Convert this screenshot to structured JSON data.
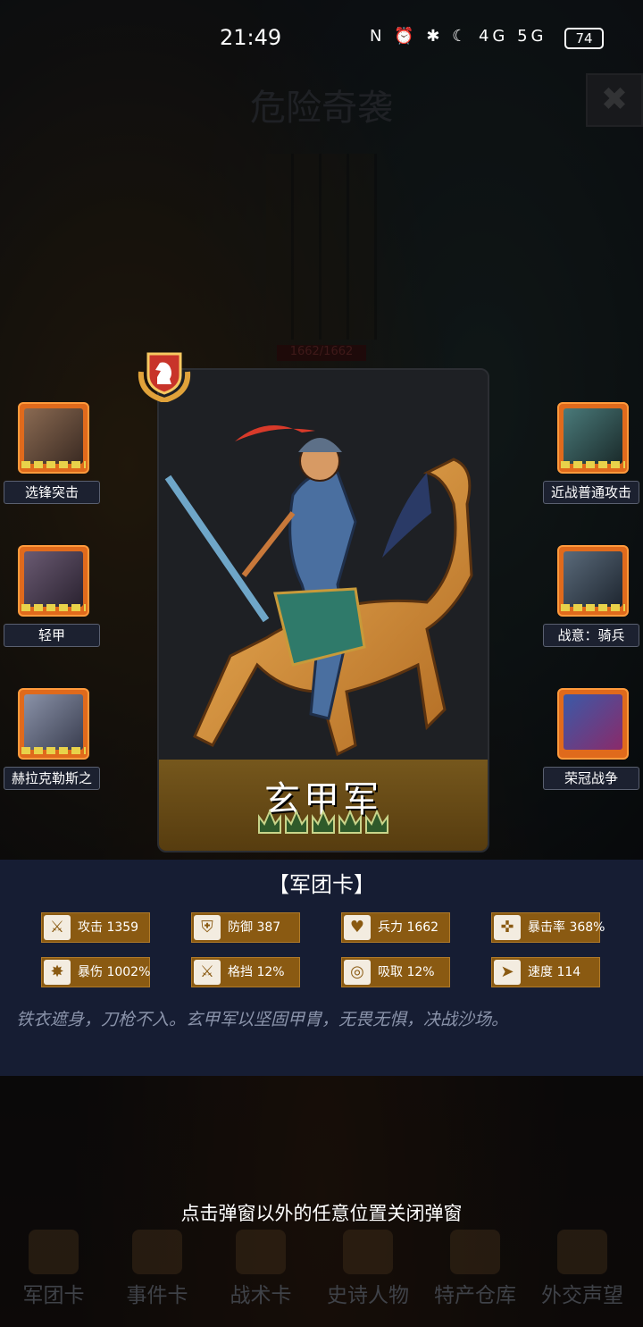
{
  "status_bar": {
    "time": "21:49",
    "icons": "N ⏰ ✱ ☾ 4G 5G",
    "battery": "74"
  },
  "header": {
    "title": "危险奇袭",
    "close_icon": "✖"
  },
  "background": {
    "hp": "1662/1662"
  },
  "card": {
    "name": "玄甲军",
    "stars": 5,
    "rank_icon": "knight-chess-icon"
  },
  "skills_left": [
    {
      "label": "选锋突击",
      "icon": "warrior-portrait-icon"
    },
    {
      "label": "轻甲",
      "icon": "hooded-rogue-icon"
    },
    {
      "label": "赫拉克勒斯之",
      "icon": "armored-knight-icon"
    }
  ],
  "skills_right": [
    {
      "label": "近战普通攻击",
      "icon": "swordsman-attack-icon"
    },
    {
      "label": "战意：骑兵",
      "icon": "cavalry-ruins-icon"
    },
    {
      "label": "荣冠战争",
      "icon": "cathedral-crown-icon"
    }
  ],
  "panel": {
    "title": "【军团卡】",
    "stats": [
      {
        "label": "攻击 1359",
        "icon": "sword-icon",
        "glyph": "⚔"
      },
      {
        "label": "防御 387",
        "icon": "shield-icon",
        "glyph": "⛨"
      },
      {
        "label": "兵力 1662",
        "icon": "heart-icon",
        "glyph": "♥"
      },
      {
        "label": "暴击率 368%",
        "icon": "crit-target-icon",
        "glyph": "✜"
      },
      {
        "label": "暴伤 1002%",
        "icon": "burst-icon",
        "glyph": "✸"
      },
      {
        "label": "格挡 12%",
        "icon": "block-icon",
        "glyph": "⚔"
      },
      {
        "label": "吸取 12%",
        "icon": "drain-icon",
        "glyph": "◎"
      },
      {
        "label": "速度 114",
        "icon": "boot-icon",
        "glyph": "➤"
      }
    ],
    "description": "铁衣遮身，刀枪不入。玄甲军以坚固甲胄，无畏无惧，决战沙场。"
  },
  "hint": "点击弹窗以外的任意位置关闭弹窗",
  "bottom_nav": [
    {
      "label": "军团卡",
      "icon": "helmet-icon"
    },
    {
      "label": "事件卡",
      "icon": "scroll-icon"
    },
    {
      "label": "战术卡",
      "icon": "tactics-icon"
    },
    {
      "label": "史诗人物",
      "icon": "crown-icon"
    },
    {
      "label": "特产仓库",
      "icon": "chest-icon"
    },
    {
      "label": "外交声望",
      "icon": "letter-icon"
    }
  ],
  "colors": {
    "panel": "#161d33",
    "accent": "#8a5a12",
    "skill_frame": "#e06a1c"
  }
}
